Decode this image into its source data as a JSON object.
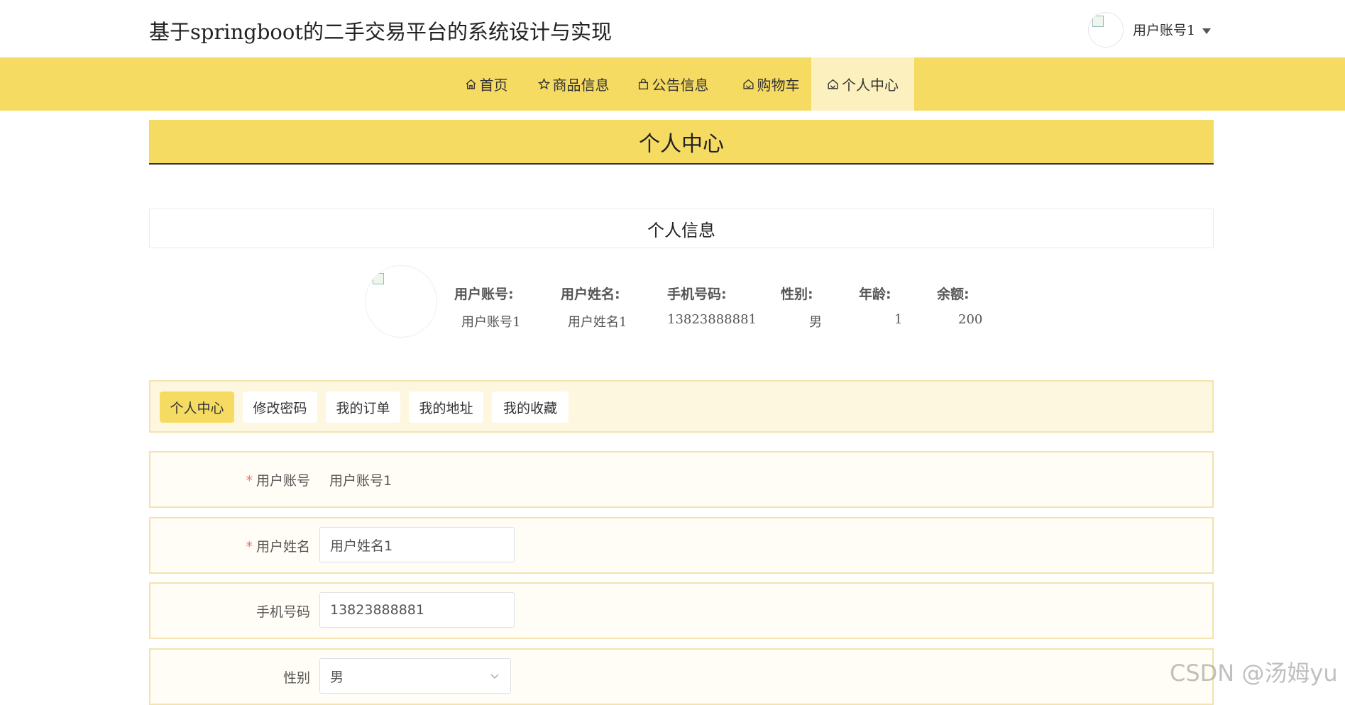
{
  "header": {
    "site_title": "基于springboot的二手交易平台的系统设计与实现",
    "user_menu_label": "用户账号1"
  },
  "nav": {
    "items": [
      {
        "label": "首页",
        "icon": "home-icon"
      },
      {
        "label": "商品信息",
        "icon": "star-icon"
      },
      {
        "label": "公告信息",
        "icon": "bag-icon"
      },
      {
        "label": "购物车",
        "icon": "cart-icon"
      },
      {
        "label": "个人中心",
        "icon": "home-icon",
        "active": true
      }
    ]
  },
  "page_title": "个人中心",
  "personal_info": {
    "heading": "个人信息",
    "fields": [
      {
        "label": "用户账号:",
        "value": "用户账号1"
      },
      {
        "label": "用户姓名:",
        "value": "用户姓名1"
      },
      {
        "label": "手机号码:",
        "value": "13823888881"
      },
      {
        "label": "性别:",
        "value": "男"
      },
      {
        "label": "年龄:",
        "value": "1"
      },
      {
        "label": "余额:",
        "value": "200"
      }
    ]
  },
  "tabs": [
    {
      "label": "个人中心",
      "active": true
    },
    {
      "label": "修改密码"
    },
    {
      "label": "我的订单"
    },
    {
      "label": "我的地址"
    },
    {
      "label": "我的收藏"
    }
  ],
  "form": {
    "account": {
      "label": "用户账号",
      "value": "用户账号1",
      "required": true
    },
    "name": {
      "label": "用户姓名",
      "value": "用户姓名1",
      "required": true
    },
    "phone": {
      "label": "手机号码",
      "value": "13823888881"
    },
    "gender": {
      "label": "性别",
      "value": "男"
    }
  },
  "watermark": "CSDN @汤姆yu",
  "colors": {
    "accent": "#f6db62",
    "accent_light": "#fdf0bf",
    "required": "#f56c6c"
  }
}
